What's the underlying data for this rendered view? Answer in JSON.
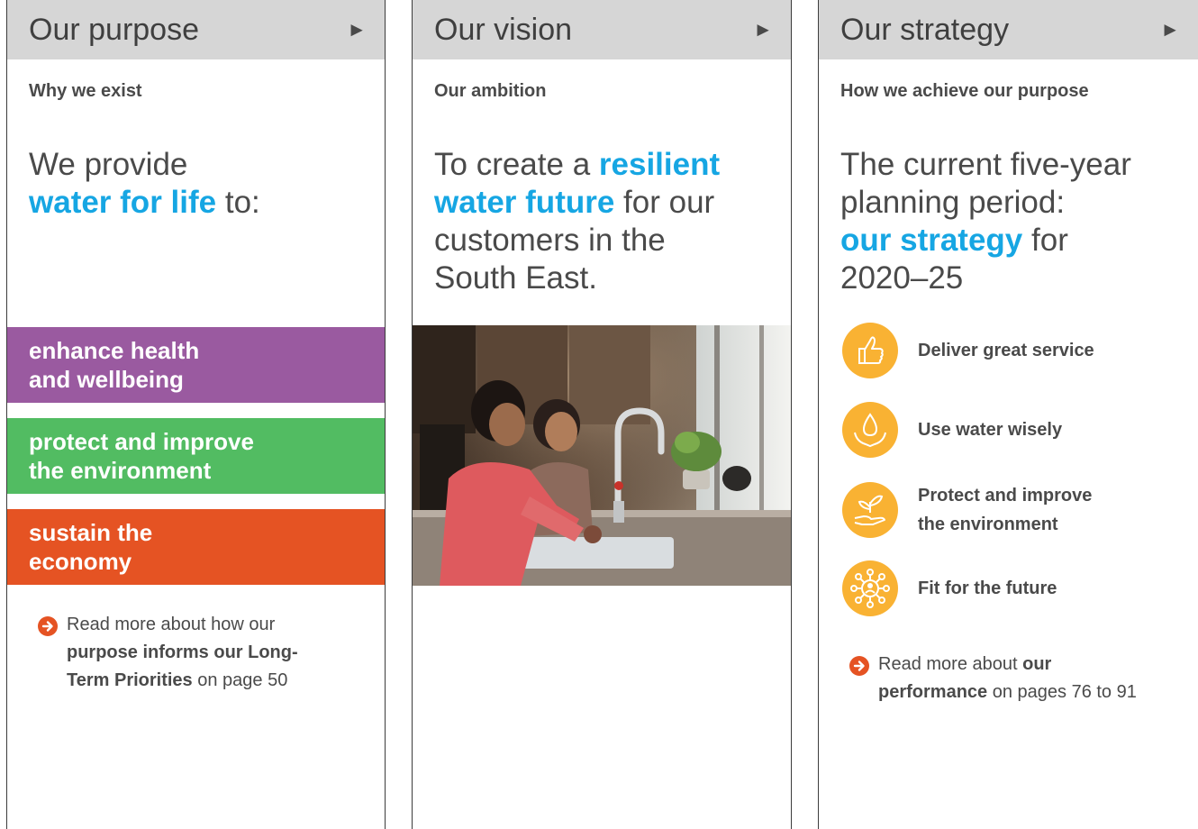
{
  "purpose": {
    "header": "Our purpose",
    "arrow": "►",
    "subheading": "Why we exist",
    "statement_lead": "We provide",
    "statement_highlight": "water for life",
    "statement_tail": "to:",
    "bands": [
      {
        "line1": "enhance health",
        "line2": "and wellbeing",
        "color": "#9a5aa0"
      },
      {
        "line1": "protect and improve",
        "line2": "the environment",
        "color": "#52bc62"
      },
      {
        "line1": "sustain the",
        "line2": "economy",
        "color": "#e55323"
      }
    ],
    "read_more": {
      "line1": "Read more about how our",
      "bold_a": "purpose informs our Long-",
      "bold_b": "Term Priorities",
      "tail": "on page 50"
    }
  },
  "vision": {
    "header": "Our vision",
    "arrow": "►",
    "subheading": "Our ambition",
    "lead": "To create a",
    "highlight_a": "resilient",
    "highlight_b": "water future",
    "line2_tail": "for our",
    "line3": "customers in the",
    "line4": "South East."
  },
  "strategy": {
    "header": "Our strategy",
    "arrow": "►",
    "subheading": "How we achieve our purpose",
    "line1": "The current five-year",
    "line2": "planning period:",
    "highlight": "our strategy",
    "line3_tail": "for",
    "line4": "2020–25",
    "objectives": [
      {
        "icon": "thumbs-up-icon",
        "label": "Deliver great service"
      },
      {
        "icon": "water-drop-hands-icon",
        "label": "Use water wisely"
      },
      {
        "icon": "plant-hand-icon",
        "label_line1": "Protect and improve",
        "label_line2": "the environment"
      },
      {
        "icon": "network-people-icon",
        "label": "Fit for the future"
      }
    ],
    "read_more": {
      "lead": "Read more about",
      "bold_a": "our",
      "bold_b": "performance",
      "tail": "on pages 76 to 91"
    }
  },
  "colors": {
    "accent_blue": "#16a6e3",
    "orange": "#e55323",
    "purple": "#9a5aa0",
    "green": "#52bc62",
    "icon_yellow": "#f9b233",
    "header_grey": "#d6d6d6"
  }
}
